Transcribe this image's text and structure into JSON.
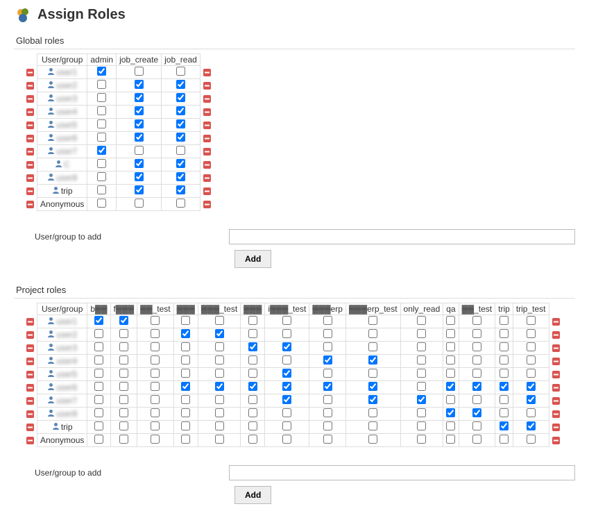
{
  "page": {
    "title": "Assign Roles"
  },
  "global": {
    "section_title": "Global roles",
    "columns_label": "User/group",
    "columns": [
      "admin",
      "job_create",
      "job_read"
    ],
    "rows": [
      {
        "user": "user1",
        "blur": true,
        "icon": "user",
        "checks": [
          true,
          false,
          false
        ]
      },
      {
        "user": "user2",
        "blur": true,
        "icon": "user",
        "checks": [
          false,
          true,
          true
        ]
      },
      {
        "user": "user3",
        "blur": true,
        "icon": "user",
        "checks": [
          false,
          true,
          true
        ]
      },
      {
        "user": "user4",
        "blur": true,
        "icon": "user",
        "checks": [
          false,
          true,
          true
        ]
      },
      {
        "user": "user5",
        "blur": true,
        "icon": "user",
        "checks": [
          false,
          true,
          true
        ]
      },
      {
        "user": "user6",
        "blur": true,
        "icon": "user",
        "checks": [
          false,
          true,
          true
        ]
      },
      {
        "user": "user7",
        "blur": true,
        "icon": "user",
        "checks": [
          true,
          false,
          false
        ]
      },
      {
        "user": "C",
        "blur": true,
        "icon": "user",
        "checks": [
          false,
          true,
          true
        ]
      },
      {
        "user": "user8",
        "blur": true,
        "icon": "user",
        "checks": [
          false,
          true,
          true
        ]
      },
      {
        "user": "trip",
        "blur": false,
        "icon": "user",
        "checks": [
          false,
          true,
          true
        ]
      },
      {
        "user": "Anonymous",
        "blur": false,
        "icon": "none",
        "checks": [
          false,
          false,
          false
        ]
      }
    ],
    "add_label": "User/group to add",
    "add_value": "",
    "add_button": "Add"
  },
  "project": {
    "section_title": "Project roles",
    "columns_label": "User/group",
    "columns": [
      "b▓▓",
      "f▓▓▓",
      "▓▓_test",
      "▓▓▓",
      "▓▓▓_test",
      "▓▓▓",
      "i▓▓▓_test",
      "▓▓▓erp",
      "▓▓▓erp_test",
      "only_read",
      "qa",
      "▓▓_test",
      "trip",
      "trip_test"
    ],
    "rows": [
      {
        "user": "user1",
        "blur": true,
        "icon": "user",
        "checks": [
          true,
          true,
          false,
          false,
          false,
          false,
          false,
          false,
          false,
          false,
          false,
          false,
          false,
          false
        ]
      },
      {
        "user": "user2",
        "blur": true,
        "icon": "user",
        "checks": [
          false,
          false,
          false,
          true,
          true,
          false,
          false,
          false,
          false,
          false,
          false,
          false,
          false,
          false
        ]
      },
      {
        "user": "user3",
        "blur": true,
        "icon": "user",
        "checks": [
          false,
          false,
          false,
          false,
          false,
          true,
          true,
          false,
          false,
          false,
          false,
          false,
          false,
          false
        ]
      },
      {
        "user": "user4",
        "blur": true,
        "icon": "user",
        "checks": [
          false,
          false,
          false,
          false,
          false,
          false,
          false,
          true,
          true,
          false,
          false,
          false,
          false,
          false
        ]
      },
      {
        "user": "user5",
        "blur": true,
        "icon": "user",
        "checks": [
          false,
          false,
          false,
          false,
          false,
          false,
          true,
          false,
          false,
          false,
          false,
          false,
          false,
          false
        ]
      },
      {
        "user": "user6",
        "blur": true,
        "icon": "user",
        "checks": [
          false,
          false,
          false,
          true,
          true,
          true,
          true,
          true,
          true,
          false,
          true,
          true,
          true,
          true
        ]
      },
      {
        "user": "user7",
        "blur": true,
        "icon": "user",
        "checks": [
          false,
          false,
          false,
          false,
          false,
          false,
          true,
          false,
          true,
          true,
          false,
          false,
          false,
          true
        ]
      },
      {
        "user": "user8",
        "blur": true,
        "icon": "user",
        "checks": [
          false,
          false,
          false,
          false,
          false,
          false,
          false,
          false,
          false,
          false,
          true,
          true,
          false,
          false
        ]
      },
      {
        "user": "trip",
        "blur": false,
        "icon": "user",
        "checks": [
          false,
          false,
          false,
          false,
          false,
          false,
          false,
          false,
          false,
          false,
          false,
          false,
          true,
          true
        ]
      },
      {
        "user": "Anonymous",
        "blur": false,
        "icon": "none",
        "checks": [
          false,
          false,
          false,
          false,
          false,
          false,
          false,
          false,
          false,
          false,
          false,
          false,
          false,
          false
        ]
      }
    ],
    "add_label": "User/group to add",
    "add_value": "",
    "add_button": "Add"
  }
}
